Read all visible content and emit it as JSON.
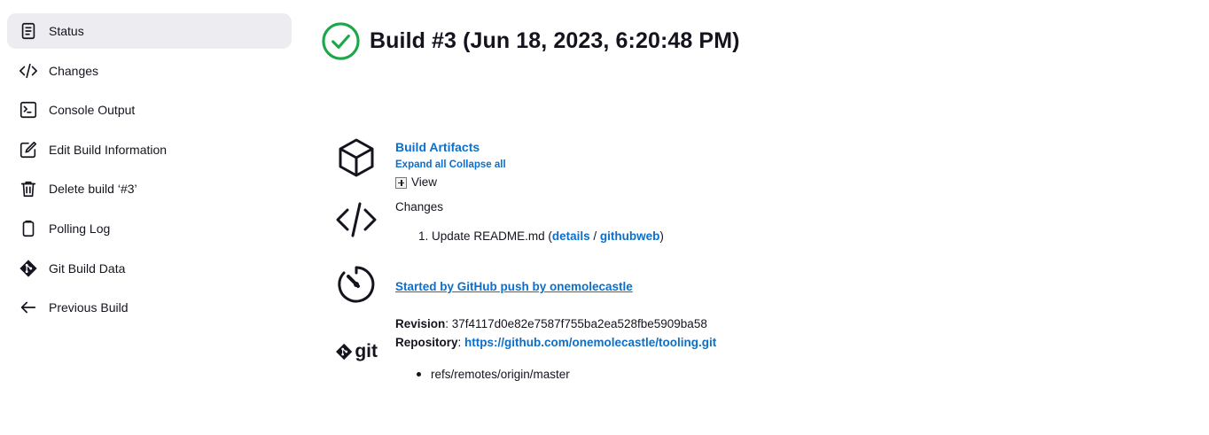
{
  "sidebar": {
    "items": [
      {
        "label": "Status",
        "icon": "status-icon",
        "active": true
      },
      {
        "label": "Changes",
        "icon": "code-icon"
      },
      {
        "label": "Console Output",
        "icon": "terminal-icon"
      },
      {
        "label": "Edit Build Information",
        "icon": "edit-icon"
      },
      {
        "label": "Delete build ‘#3’",
        "icon": "trash-icon"
      },
      {
        "label": "Polling Log",
        "icon": "clipboard-icon"
      },
      {
        "label": "Git Build Data",
        "icon": "git-icon"
      },
      {
        "label": "Previous Build",
        "icon": "arrow-left-icon"
      }
    ]
  },
  "header": {
    "title": "Build #3 (Jun 18, 2023, 6:20:48 PM)",
    "status_color": "#1ea64b"
  },
  "artifacts": {
    "title": "Build Artifacts",
    "expand_all": "Expand all",
    "collapse_all": "Collapse all",
    "view": "View"
  },
  "changes": {
    "heading": "Changes",
    "items": [
      {
        "number": "1.",
        "text": "Update README.md (",
        "details": "details",
        "sep": " / ",
        "githubweb": "githubweb",
        "close": ")"
      }
    ]
  },
  "trigger": {
    "text": "Started by GitHub push by onemolecastle"
  },
  "git": {
    "logo_text": "git",
    "revision_label": "Revision",
    "revision_value": ": 37f4117d0e82e7587f755ba2ea528fbe5909ba58",
    "repository_label": "Repository",
    "repository_sep": ": ",
    "repository_url": "https://github.com/onemolecastle/tooling.git",
    "branches": [
      "refs/remotes/origin/master"
    ]
  },
  "colors": {
    "accent": "#0b6fcb",
    "active_bg": "#ececf1",
    "success": "#1ea64b"
  }
}
